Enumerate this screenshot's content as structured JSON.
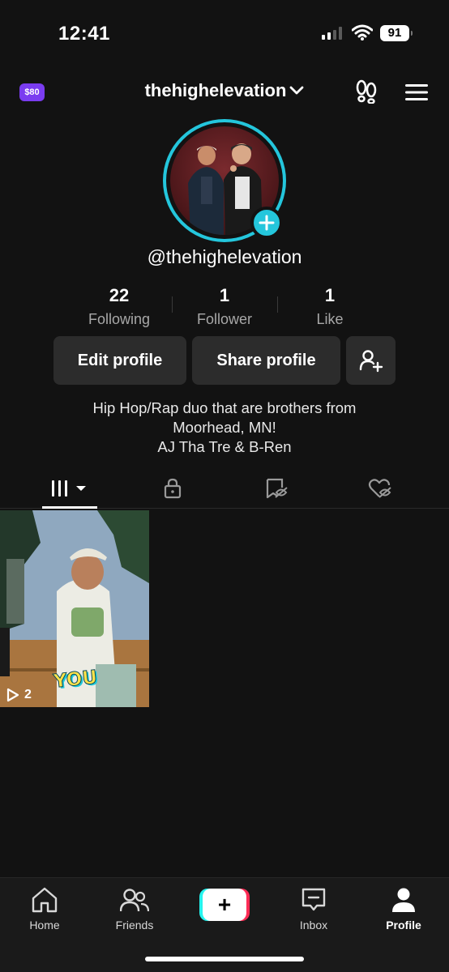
{
  "status_bar": {
    "time": "12:41",
    "battery": "91",
    "signal_bars_active": 2,
    "signal_bars_total": 4
  },
  "header": {
    "coins_badge": "$80",
    "username": "thehighelevation",
    "icons": [
      "chevron-down-icon",
      "footprint-icon",
      "menu-icon"
    ]
  },
  "profile": {
    "handle": "@thehighelevation",
    "stats": [
      {
        "value": "22",
        "label": "Following"
      },
      {
        "value": "1",
        "label": "Follower"
      },
      {
        "value": "1",
        "label": "Like"
      }
    ],
    "edit_button": "Edit profile",
    "share_button": "Share profile",
    "bio_lines": [
      "Hip Hop/Rap duo that are brothers from",
      "Moorhead, MN!",
      "AJ Tha Tre & B-Ren"
    ]
  },
  "tabs": [
    {
      "icon": "videos-grid-icon",
      "active": true
    },
    {
      "icon": "lock-icon",
      "active": false
    },
    {
      "icon": "repost-icon",
      "active": false
    },
    {
      "icon": "liked-hidden-icon",
      "active": false
    }
  ],
  "videos": [
    {
      "plays": "2",
      "sticker_text": "YOU"
    }
  ],
  "nav": {
    "home": "Home",
    "friends": "Friends",
    "inbox": "Inbox",
    "profile": "Profile",
    "create_symbol": "+"
  },
  "colors": {
    "background": "#121212",
    "accent_cyan": "#24c6dc",
    "coin_purple": "#7a3cf0",
    "tiktok_pink": "#fe2c55",
    "tiktok_cyan": "#25f4ee"
  }
}
